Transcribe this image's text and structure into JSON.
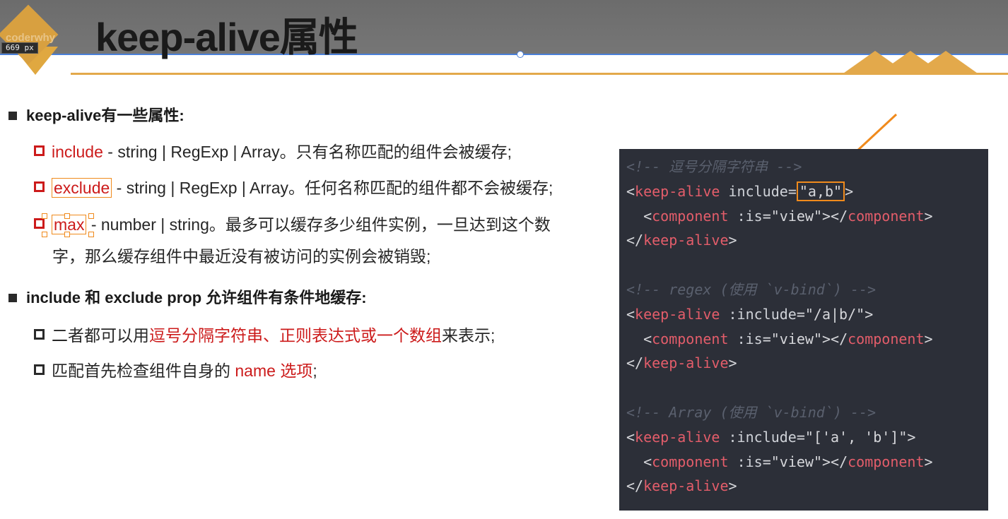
{
  "overlay": {
    "ruler_label": "669 px"
  },
  "logo": {
    "text": "coderwhy"
  },
  "title": "keep-alive属性",
  "colors": {
    "accent_gold": "#e3a94b",
    "red_text": "#cc1b1b",
    "highlight_orange": "#f08a1c",
    "code_bg": "#2c2f38"
  },
  "section1": {
    "heading": "keep-alive有一些属性:",
    "items": [
      {
        "name": "include",
        "desc": " - string | RegExp | Array。只有名称匹配的组件会被缓存;"
      },
      {
        "name": "exclude",
        "desc": " - string | RegExp | Array。任何名称匹配的组件都不会被缓存;"
      },
      {
        "name": "max",
        "desc": " - number | string。最多可以缓存多少组件实例，一旦达到这个数",
        "desc2": "字，那么缓存组件中最近没有被访问的实例会被销毁;"
      }
    ]
  },
  "section2": {
    "heading": "include 和 exclude prop 允许组件有条件地缓存:",
    "items": [
      {
        "pre": "二者都可以用",
        "red": "逗号分隔字符串、正则表达式或一个数组",
        "post": "来表示;"
      },
      {
        "pre": "匹配首先检查组件自身的 ",
        "red": "name 选项",
        "post": ";"
      }
    ]
  },
  "code": {
    "c1": "<!-- 逗号分隔字符串 -->",
    "c2": "<!-- regex (使用 `v-bind`) -->",
    "c3": "<!-- Array (使用 `v-bind`) -->",
    "tag_keep": "keep-alive",
    "tag_comp": "component",
    "attr_include": "include",
    "attr_bind_include": ":include",
    "attr_is": ":is",
    "val_ab": "\"a,b\"",
    "val_regex": "\"/a|b/\"",
    "val_array": "\"['a', 'b']\"",
    "val_view": "\"view\""
  }
}
